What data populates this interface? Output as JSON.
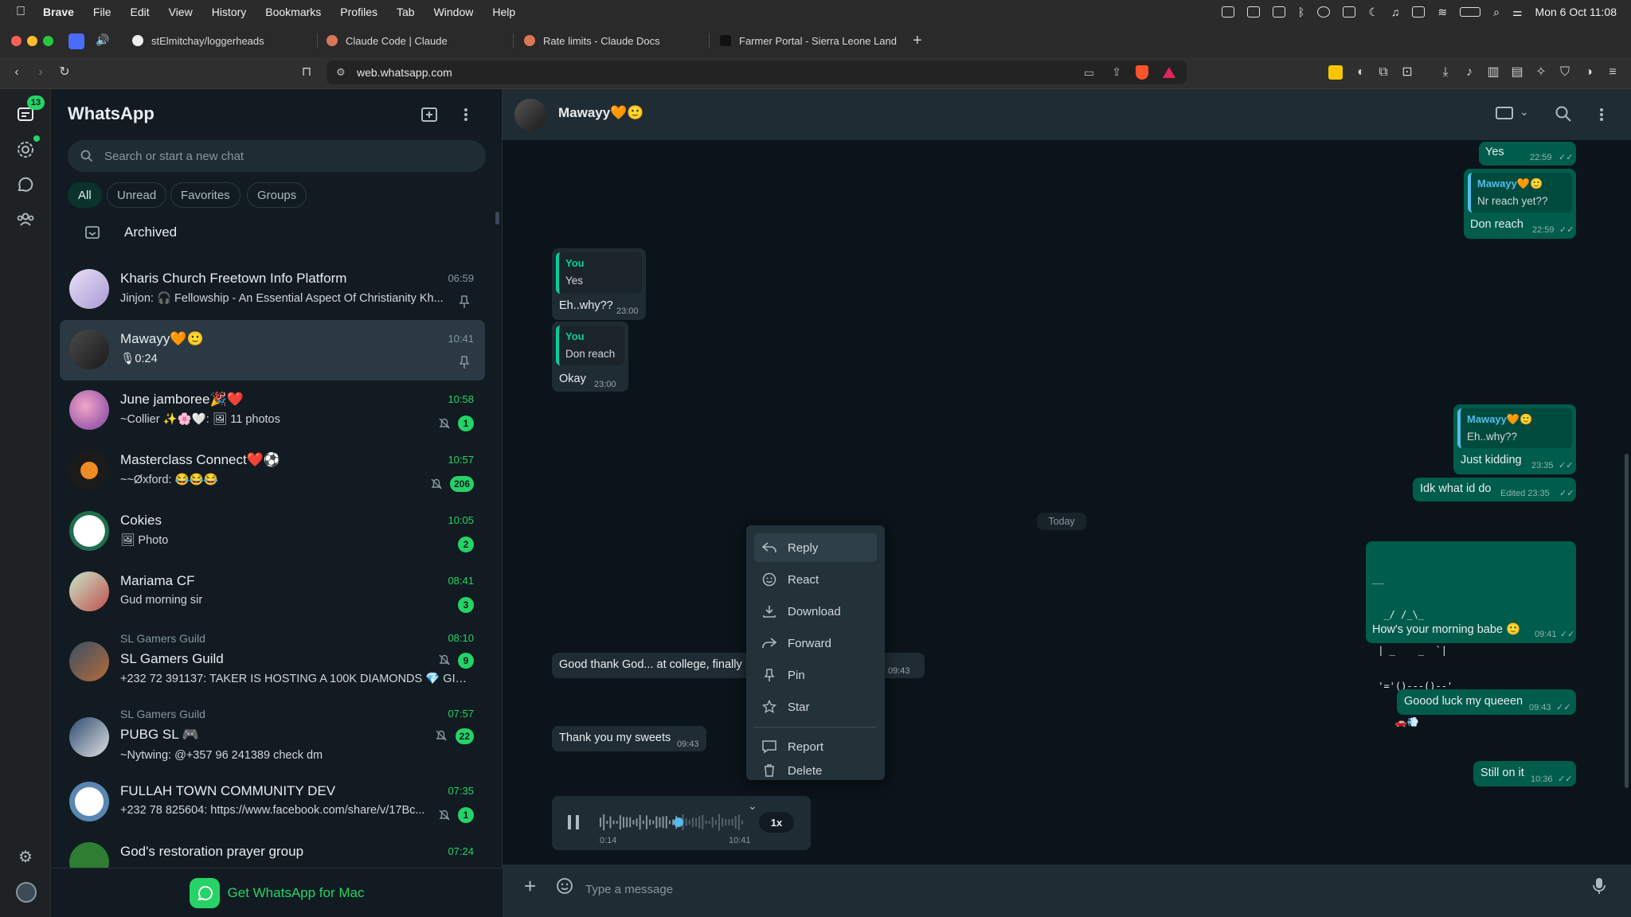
{
  "menubar": {
    "app": "Brave",
    "items": [
      "File",
      "Edit",
      "View",
      "History",
      "Bookmarks",
      "Profiles",
      "Tab",
      "Window",
      "Help"
    ],
    "datetime": "Mon 6 Oct  11:08"
  },
  "tabs": [
    {
      "title": "stElmitchay/loggerheads"
    },
    {
      "title": "Claude Code | Claude"
    },
    {
      "title": "Rate limits - Claude Docs"
    },
    {
      "title": "Farmer Portal - Sierra Leone Land"
    }
  ],
  "url": "web.whatsapp.com",
  "rail": {
    "unread_badge": "13"
  },
  "sidebar": {
    "title": "WhatsApp",
    "search_placeholder": "Search or start a new chat",
    "filters": [
      "All",
      "Unread",
      "Favorites",
      "Groups"
    ],
    "archived_label": "Archived",
    "get_app": "Get WhatsApp for Mac"
  },
  "chats": [
    {
      "name": "Kharis Church Freetown Info Platform",
      "preview": "Jinjon: 🎧 Fellowship - An Essential Aspect Of Christianity  Kh...",
      "time": "06:59",
      "unread": "",
      "pinned": true
    },
    {
      "name": "Mawayy🧡🙂",
      "preview": "🎙0:24",
      "time": "10:41",
      "unread": "",
      "pinned": true
    },
    {
      "name": "June jamboree🎉❤️",
      "preview": "~Collier ✨🌸🤍: 🖼 11 photos",
      "time": "10:58",
      "unread": "1",
      "muted": true
    },
    {
      "name": "Masterclass Connect❤️⚽",
      "preview": "~~Øxford: 😂😂😂",
      "time": "10:57",
      "unread": "206",
      "muted": true
    },
    {
      "name": "Cokies",
      "preview": "🖼 Photo",
      "time": "10:05",
      "unread": "2"
    },
    {
      "name": "Mariama CF",
      "preview": "Gud morning sir",
      "time": "08:41",
      "unread": "3"
    },
    {
      "group": "SL Gamers Guild",
      "name": "SL Gamers Guild",
      "preview": "+232 72 391137: TAKER IS HOSTING A 100K DIAMONDS 💎 GIVE...",
      "time": "08:10",
      "unread": "9",
      "muted": true
    },
    {
      "group": "SL Gamers Guild",
      "name": "PUBG SL 🎮",
      "preview": "~Nytwing: @+357 96 241389 check dm",
      "time": "07:57",
      "unread": "22",
      "muted": true
    },
    {
      "name": "FULLAH TOWN COMMUNITY DEV",
      "preview": "+232 78 825604: https://www.facebook.com/share/v/17Bc...",
      "time": "07:35",
      "unread": "1",
      "muted": true
    },
    {
      "name": "God's restoration prayer group",
      "preview": "",
      "time": "07:24",
      "unread": ""
    }
  ],
  "conversation": {
    "contact": "Mawayy🧡🙂",
    "today_label": "Today",
    "compose_placeholder": "Type a message",
    "messages": {
      "m1": {
        "text": "Yes",
        "time": "22:59"
      },
      "m2": {
        "quote_name": "Mawayy🧡🙂",
        "quote_text": "Nr reach yet??",
        "text": "Don reach",
        "time": "22:59"
      },
      "m3": {
        "quote_name": "You",
        "quote_text": "Yes",
        "text": "Eh..why??",
        "time": "23:00"
      },
      "m4": {
        "quote_name": "You",
        "quote_text": "Don reach",
        "text": "Okay",
        "time": "23:00"
      },
      "m5": {
        "quote_name": "Mawayy🧡🙂",
        "quote_text": "Eh..why??",
        "text": "Just kidding",
        "time": "23:35"
      },
      "m6": {
        "text": "Idk what id do",
        "time": "Edited 23:35"
      },
      "m7": {
        "art": [
          "__",
          "  _/ /_\\_",
          " | _    _  `|",
          " '='()---()--'",
          "    🚗💨"
        ],
        "text": "How's your morning babe 🙂",
        "time": "09:41"
      },
      "m8": {
        "text": "Good thank God... at college, finally",
        "time": "09:43"
      },
      "m9": {
        "text": "Goood luck my queeen",
        "time": "09:43"
      },
      "m10": {
        "text": "Thank you my sweets",
        "time": "09:43"
      },
      "m11": {
        "text": "Still on it",
        "time": "10:36"
      }
    },
    "voice": {
      "elapsed": "0:14",
      "time": "10:41",
      "speed": "1x",
      "progress": 0.55
    }
  },
  "context_menu": [
    "Reply",
    "React",
    "Download",
    "Forward",
    "Pin",
    "Star",
    "Report",
    "Delete"
  ],
  "colors": {
    "accent": "#25d366",
    "outgoing": "#005c4b",
    "incoming": "#202c33",
    "panel": "#111b21"
  }
}
